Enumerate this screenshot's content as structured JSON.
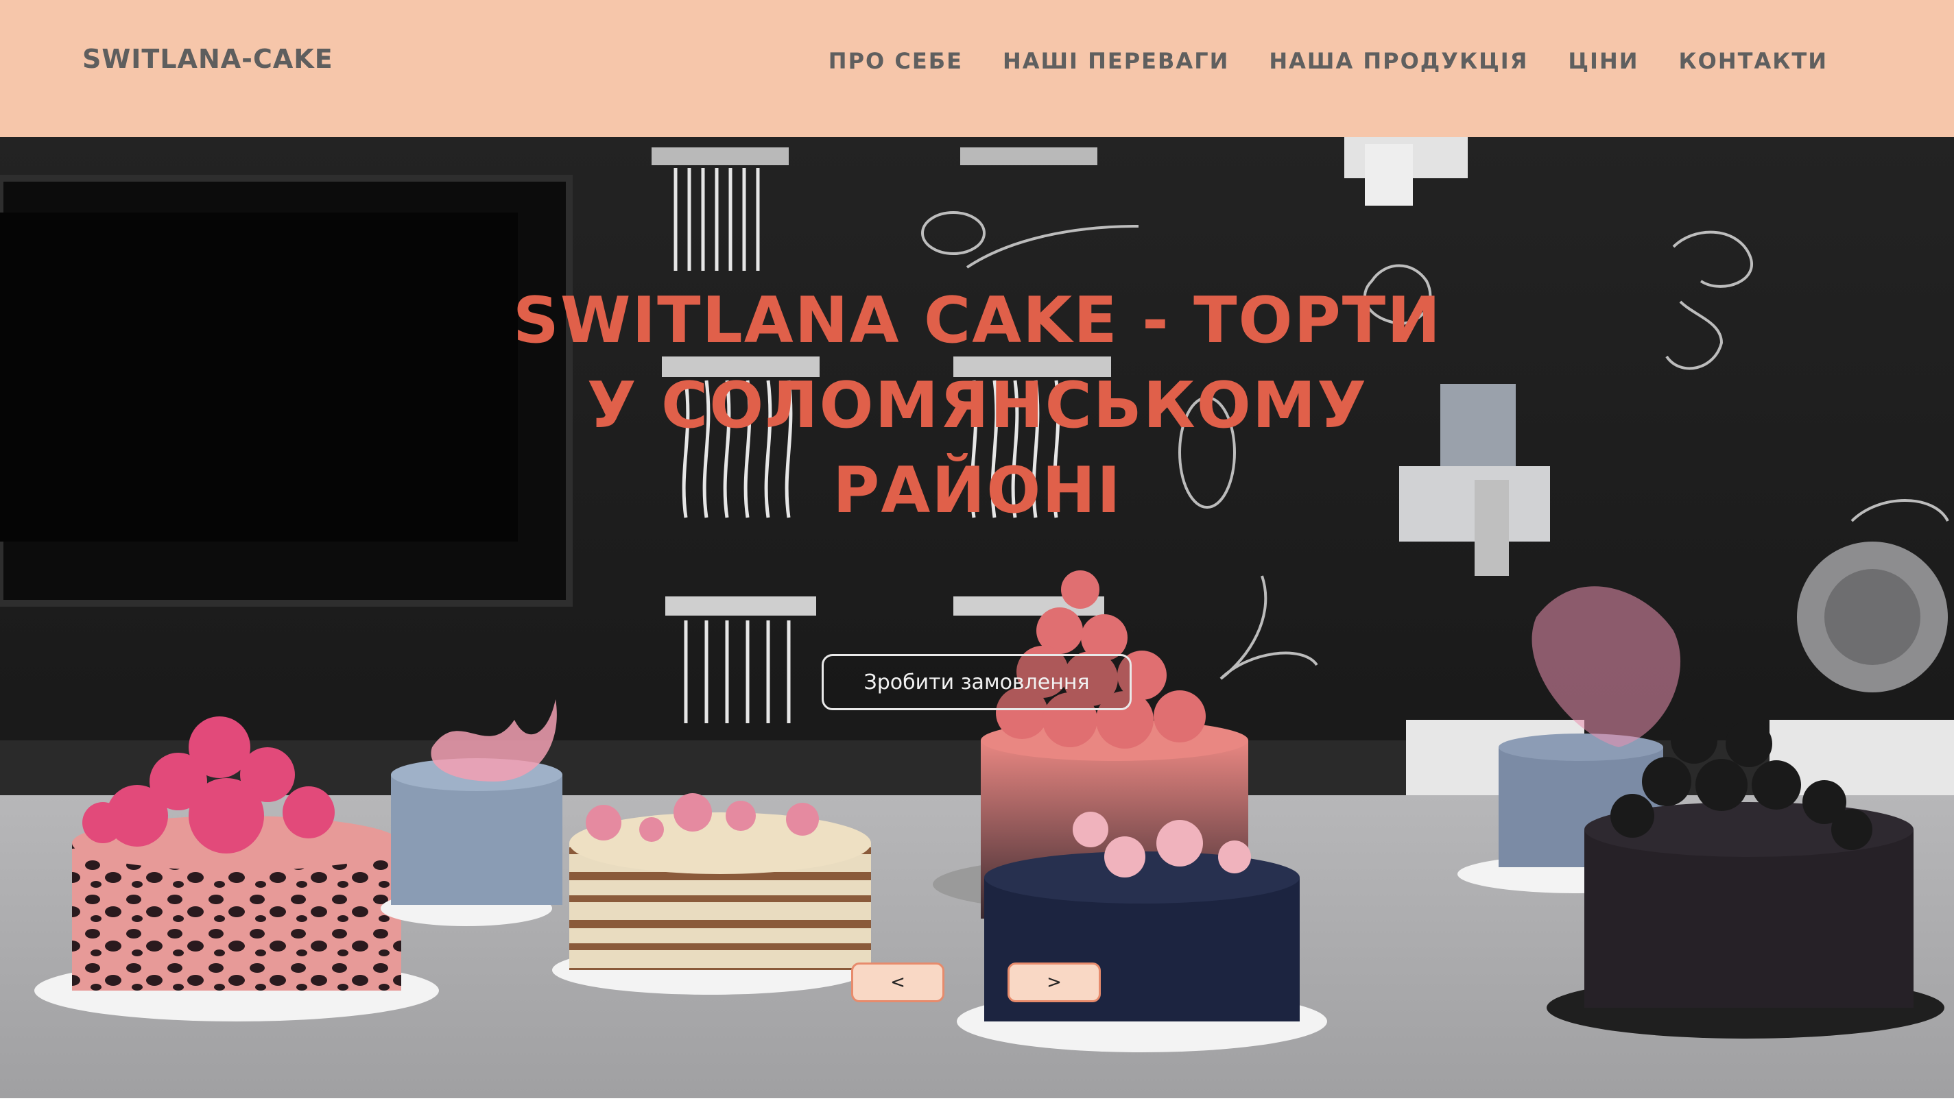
{
  "header": {
    "brand": "SWITLANA-CAKE",
    "nav": [
      {
        "label": "ПРО СЕБЕ"
      },
      {
        "label": "НАШІ ПЕРЕВАГИ"
      },
      {
        "label": "НАША ПРОДУКЦІЯ"
      },
      {
        "label": "ЦІНИ"
      },
      {
        "label": "КОНТАКТИ"
      }
    ]
  },
  "hero": {
    "title": "SWITLANA CAKE - ТОРТИ У СОЛОМЯНСЬКОМУ РАЙОНІ",
    "order_button": "Зробити замовлення",
    "prev_label": "<",
    "next_label": ">"
  },
  "colors": {
    "header_bg": "#f6c6aa",
    "title_accent": "#e0604a",
    "nav_text": "#5f5f5f",
    "arrow_bg": "#f9d8c5",
    "arrow_border": "#e78b6c"
  }
}
